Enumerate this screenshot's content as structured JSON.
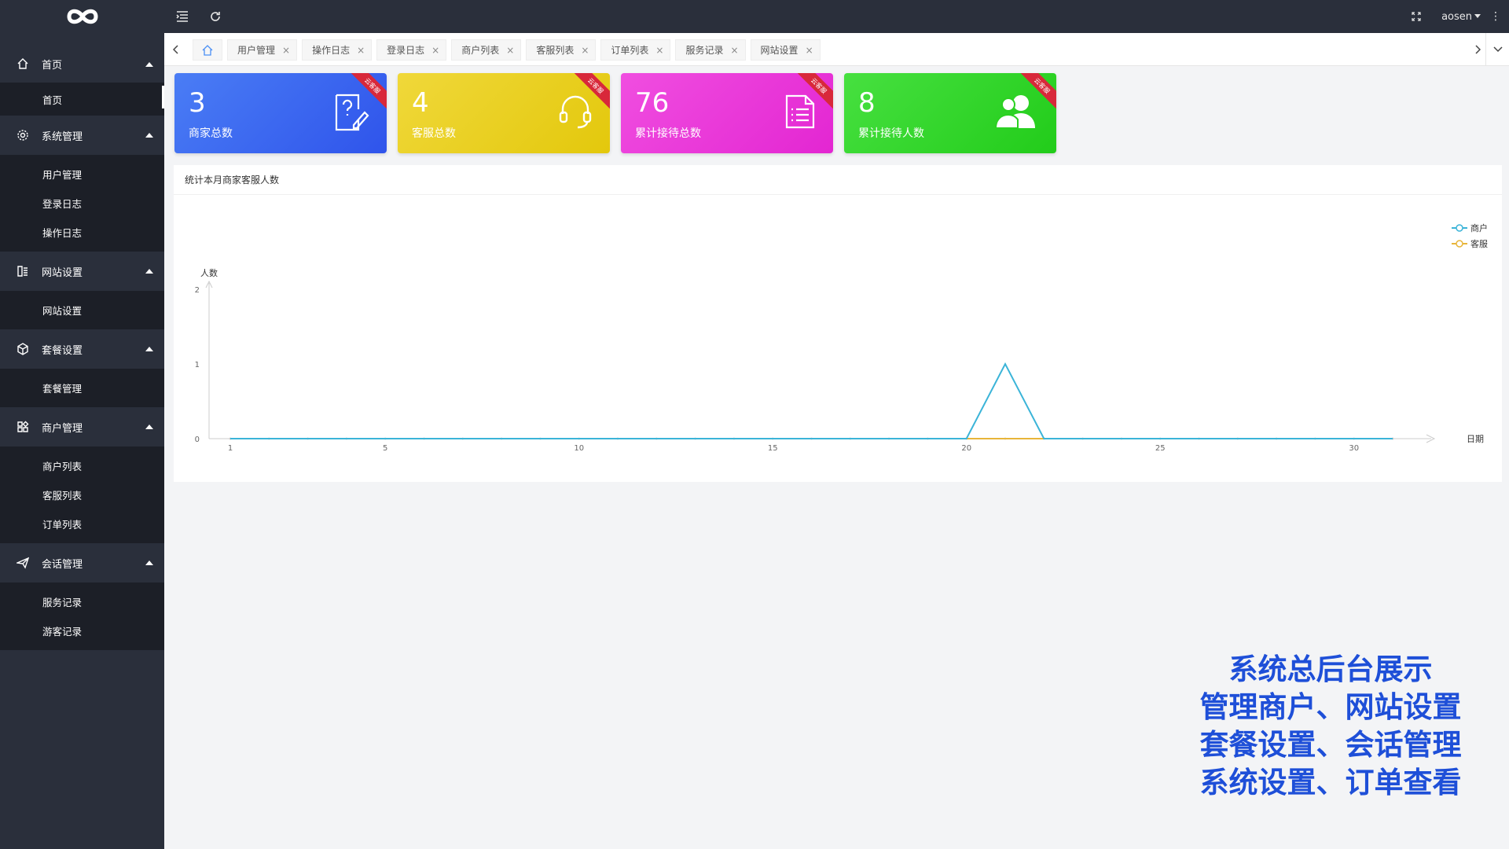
{
  "header": {
    "user_name": "aosen",
    "more_icon": "⋮"
  },
  "sidebar": {
    "groups": [
      {
        "label": "首页",
        "icon": "home-icon",
        "items": [
          {
            "label": "首页",
            "active": true
          }
        ]
      },
      {
        "label": "系统管理",
        "icon": "gear-icon",
        "items": [
          {
            "label": "用户管理"
          },
          {
            "label": "登录日志"
          },
          {
            "label": "操作日志"
          }
        ]
      },
      {
        "label": "网站设置",
        "icon": "website-icon",
        "items": [
          {
            "label": "网站设置"
          }
        ]
      },
      {
        "label": "套餐设置",
        "icon": "package-icon",
        "items": [
          {
            "label": "套餐管理"
          }
        ]
      },
      {
        "label": "商户管理",
        "icon": "apps-icon",
        "items": [
          {
            "label": "商户列表"
          },
          {
            "label": "客服列表"
          },
          {
            "label": "订单列表"
          }
        ]
      },
      {
        "label": "会话管理",
        "icon": "send-icon",
        "items": [
          {
            "label": "服务记录"
          },
          {
            "label": "游客记录"
          }
        ]
      }
    ]
  },
  "tabs": [
    "用户管理",
    "操作日志",
    "登录日志",
    "商户列表",
    "客服列表",
    "订单列表",
    "服务记录",
    "网站设置"
  ],
  "tab_close": "×",
  "cards": [
    {
      "value": "3",
      "label": "商家总数",
      "ribbon": "云客服",
      "icon": "question-edit-icon",
      "color_from": "#4a7df5",
      "color_to": "#2f54eb"
    },
    {
      "value": "4",
      "label": "客服总数",
      "ribbon": "云客服",
      "icon": "headset-icon",
      "color_from": "#f0d83a",
      "color_to": "#e3c80c"
    },
    {
      "value": "76",
      "label": "累计接待总数",
      "ribbon": "云客服",
      "icon": "document-icon",
      "color_from": "#f04ee0",
      "color_to": "#e326d2"
    },
    {
      "value": "8",
      "label": "累计接待人数",
      "ribbon": "云客服",
      "icon": "users-icon",
      "color_from": "#47e040",
      "color_to": "#22cc1a"
    }
  ],
  "panel": {
    "title": "统计本月商家客服人数"
  },
  "chart_data": {
    "type": "line",
    "xlabel": "日期",
    "ylabel": "人数",
    "x": [
      1,
      2,
      3,
      4,
      5,
      6,
      7,
      8,
      9,
      10,
      11,
      12,
      13,
      14,
      15,
      16,
      17,
      18,
      19,
      20,
      21,
      22,
      23,
      24,
      25,
      26,
      27,
      28,
      29,
      30,
      31
    ],
    "x_ticks": [
      "1",
      "5",
      "10",
      "15",
      "20",
      "25",
      "30"
    ],
    "y_ticks": [
      "0",
      "1",
      "2"
    ],
    "ylim": [
      0,
      2
    ],
    "legend_position": "top-right",
    "series": [
      {
        "name": "商户",
        "color": "#3bb4d8",
        "values": [
          0,
          0,
          0,
          0,
          0,
          0,
          0,
          0,
          0,
          0,
          0,
          0,
          0,
          0,
          0,
          0,
          0,
          0,
          0,
          0,
          1,
          0,
          0,
          0,
          0,
          0,
          0,
          0,
          0,
          0,
          0
        ]
      },
      {
        "name": "客服",
        "color": "#e8b53a",
        "values": [
          0,
          0,
          0,
          0,
          0,
          0,
          0,
          0,
          0,
          0,
          0,
          0,
          0,
          0,
          0,
          0,
          0,
          0,
          0,
          0,
          0,
          0,
          0,
          0,
          0,
          0,
          0,
          0,
          0,
          0,
          0
        ]
      }
    ]
  },
  "caption": [
    "系统总后台展示",
    "管理商户、网站设置",
    "套餐设置、会话管理",
    "系统设置、订单查看"
  ]
}
